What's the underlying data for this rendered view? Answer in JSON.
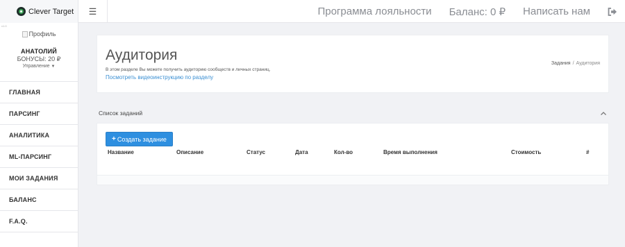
{
  "brand": {
    "name": "Clever Target"
  },
  "header": {
    "links": [
      "Программа лояльности",
      "Баланс: 0 ₽",
      "Написать нам"
    ]
  },
  "profile": {
    "tiny_label": "v1.0",
    "avatar_alt": "Профиль",
    "name": "АНАТОЛИЙ",
    "bonus": "БОНУСЫ: 20 ₽",
    "manage": "Управление"
  },
  "menu": [
    "ГЛАВНАЯ",
    "ПАРСИНГ",
    "АНАЛИТИКА",
    "ML-ПАРСИНГ",
    "МОИ ЗАДАНИЯ",
    "БАЛАНС",
    "F.A.Q."
  ],
  "page": {
    "title": "Аудитория",
    "description": "В этом разделе Вы можете получить аудиторию сообществ и личных страниц.",
    "video_link": "Посмотреть видеоинструкцию по разделу",
    "breadcrumb": {
      "parent": "Задания",
      "sep": "/",
      "current": "Аудитория"
    }
  },
  "tasks": {
    "title": "Список заданий",
    "create_button": "Создать задание",
    "columns": [
      "Название",
      "Описание",
      "Статус",
      "Дата",
      "Кол-во",
      "Время выполнения",
      "Стоимость",
      "#"
    ]
  },
  "colors": {
    "accent": "#2e8fe0",
    "link": "#3a8fd3",
    "brand_green": "#3fa65a"
  }
}
